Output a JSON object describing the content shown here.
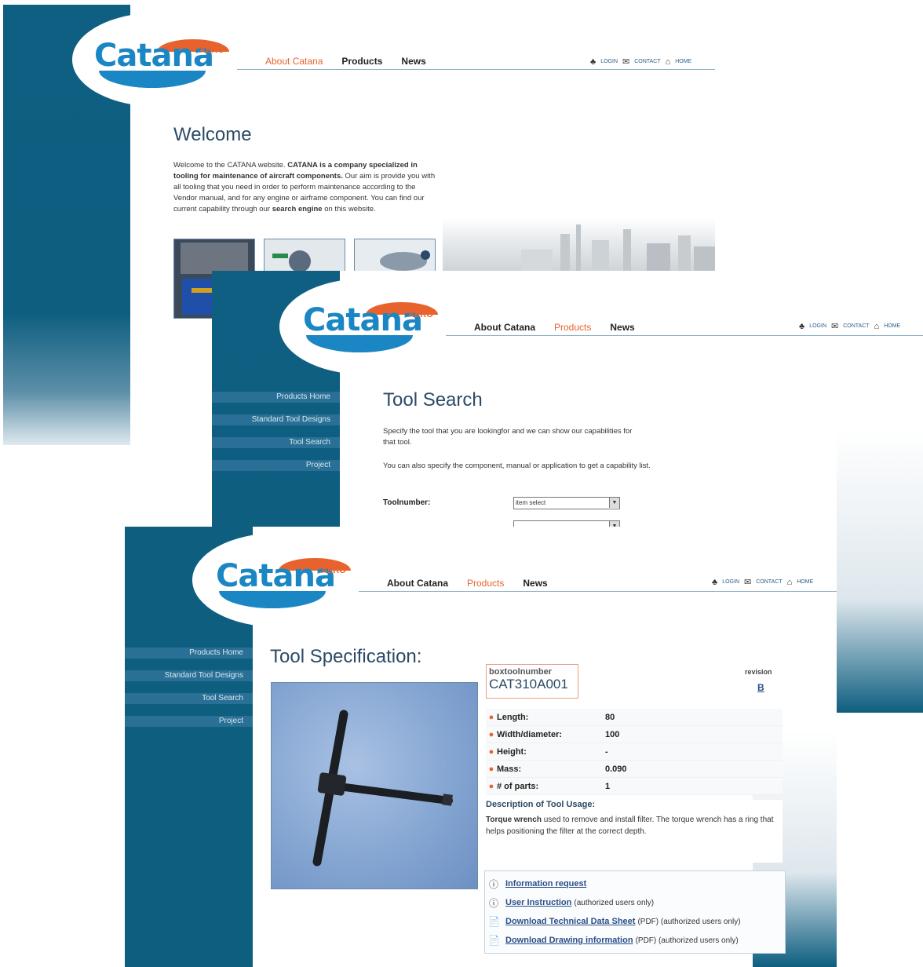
{
  "brand": {
    "name": "Catana",
    "suffix": "AERO"
  },
  "nav": {
    "items": [
      "About Catana",
      "Products",
      "News"
    ]
  },
  "util": {
    "login": "LOGIN",
    "contact": "CONTACT",
    "home": "HOME"
  },
  "sidebar": {
    "items": [
      "Products Home",
      "Standard Tool Designs",
      "Tool Search",
      "Project"
    ]
  },
  "screen1": {
    "title": "Welcome",
    "p1": "Welcome to the CATANA website. ",
    "p1_bold": "CATANA is a company specialized in tooling for maintenance of aircraft components.",
    "p2": " Our aim is provide you with all tooling that you need in order to perform maintenance according to the Vendor manual, and for any engine or airframe component. You can find our current capability through our ",
    "p2_bold": "search engine",
    "p3": " on this website."
  },
  "screen2": {
    "title": "Tool Search",
    "intro1": "Specify the tool that you are lookingfor and we can show our capabilities for that tool.",
    "intro2": "You can also specify the component, manual or application to get a capability list.",
    "toolnumber_label": "Toolnumber:",
    "toolnumber_value": "item select"
  },
  "screen3": {
    "title": "Tool Specification:",
    "box_label": "boxtoolnumber",
    "box_value": "CAT310A001",
    "revision_label": "revision",
    "revision_value": "B",
    "specs": [
      {
        "k": "Length:",
        "v": "80"
      },
      {
        "k": "Width/diameter:",
        "v": "100"
      },
      {
        "k": "Height:",
        "v": "-"
      },
      {
        "k": "Mass:",
        "v": "0.090"
      },
      {
        "k": "# of parts:",
        "v": "1"
      }
    ],
    "desc_title": "Description of Tool Usage:",
    "desc_bold": "Torque wrench",
    "desc_text": " used to remove and install filter. The torque wrench has a ring that helps positioning the filter at the correct depth.",
    "links": [
      {
        "text": "Information request",
        "note": "",
        "icon": "info-icon"
      },
      {
        "text": "User Instruction",
        "note": "(authorized users only)",
        "icon": "info-icon"
      },
      {
        "text": "Download Technical Data Sheet",
        "note": "(PDF) (authorized users only)",
        "icon": "pdf-icon"
      },
      {
        "text": "Download Drawing information",
        "note": "(PDF) (authorized users only)",
        "icon": "pdf-icon"
      }
    ]
  },
  "colors": {
    "accent": "#e8622e",
    "brand_blue": "#1a86c3",
    "sidebar": "#0e5e80"
  }
}
